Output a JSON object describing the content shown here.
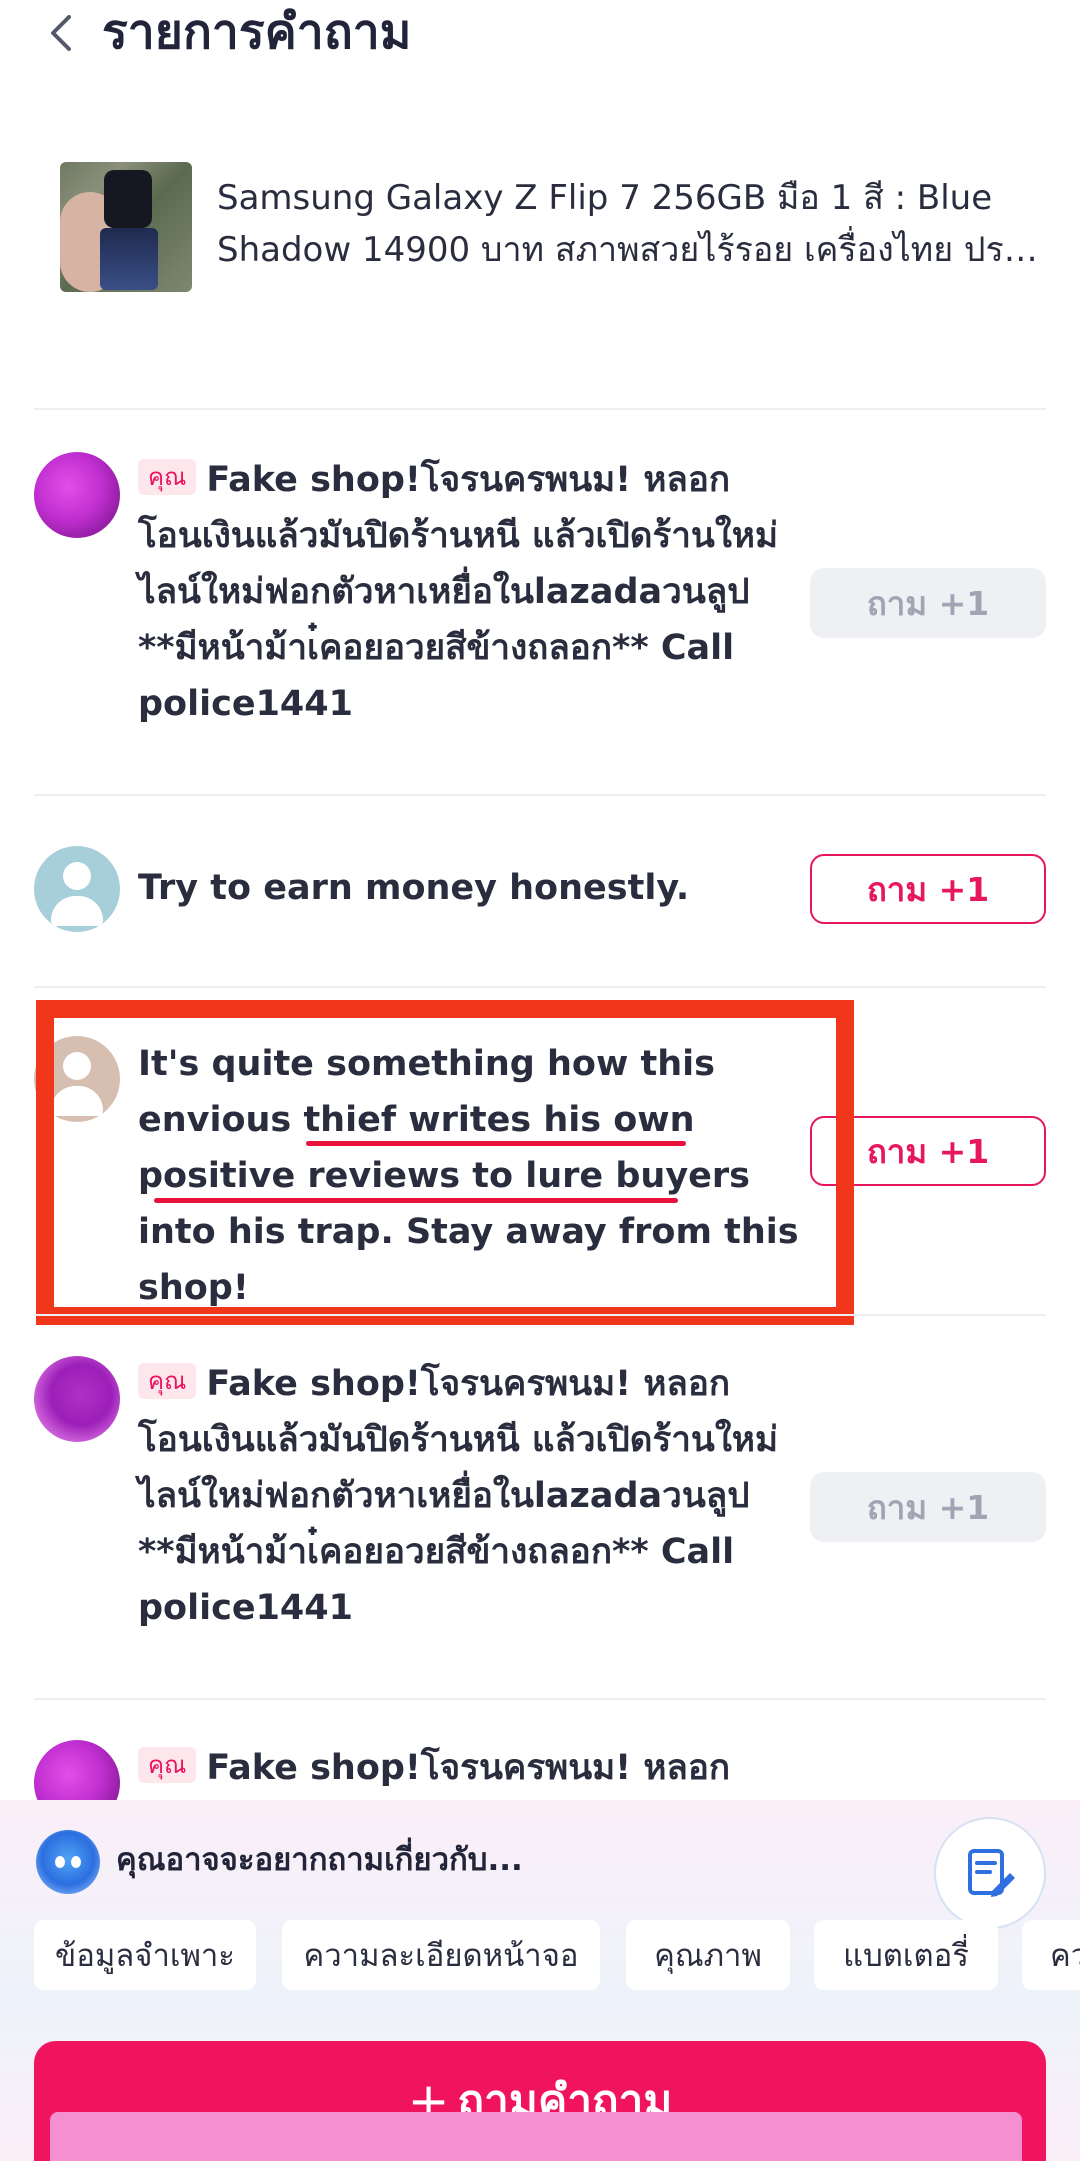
{
  "header": {
    "title": "รายการคำถาม"
  },
  "product": {
    "title": "Samsung Galaxy Z Flip 7 256GB มือ 1  สี : Blue Shadow 14900 บาท สภาพสวยไร้รอย เครื่องไทย ประกั..."
  },
  "questions": [
    {
      "you_tag": "คุณ",
      "text": "Fake shop!โจรนครพนม! หลอก โอนเงินแล้วมันปิดร้านหนี แล้วเปิดร้านใหม่ไลน์ใหม่ฟอกตัวหาเหยื่อในlazadaวนลูป **มีหน้าม้าเ๋คอยอวยสีข้างถลอก** Call police1441",
      "ask_label": "ถาม +1"
    },
    {
      "text": "Try to earn money honestly.",
      "ask_label": "ถาม +1"
    },
    {
      "text": "It's quite something how this envious thief writes his own positive reviews to lure buyers into his trap. Stay away from this shop!",
      "ask_label": "ถาม +1"
    },
    {
      "you_tag": "คุณ",
      "text": "Fake shop!โจรนครพนม! หลอก โอนเงินแล้วมันปิดร้านหนี แล้วเปิดร้านใหม่ไลน์ใหม่ฟอกตัวหาเหยื่อในlazadaวนลูป **มีหน้าม้าเ๋คอยอวยสีข้างถลอก** Call police1441",
      "ask_label": "ถาม +1"
    },
    {
      "you_tag": "คุณ",
      "text": "Fake shop!โจรนครพนม! หลอก โอน"
    }
  ],
  "suggestions": {
    "label": "คุณอาจจะอยากถามเกี่ยวกับ...",
    "chips": [
      "ข้อมูลจำเพาะ",
      "ความละเอียดหน้าจอ",
      "คุณภาพ",
      "แบตเตอรี่",
      "คว"
    ]
  },
  "ask_question": {
    "plus": "+",
    "label": "ถามคำถาม"
  },
  "colors": {
    "accent": "#f0135e",
    "highlight": "#f1361b"
  }
}
